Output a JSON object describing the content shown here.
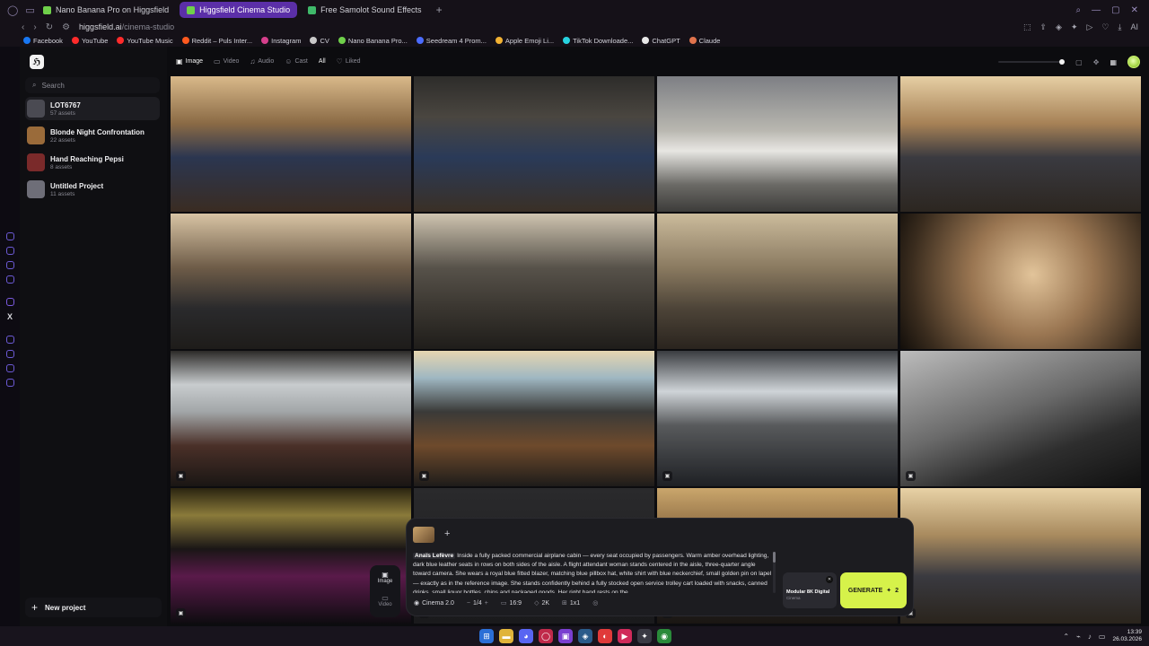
{
  "browser": {
    "tabs": [
      {
        "label": "Nano Banana Pro on Higgsfield",
        "color": "#6fd04a",
        "active": false
      },
      {
        "label": "Higgsfield Cinema Studio",
        "color": "#6fd04a",
        "active": true
      },
      {
        "label": "Free Samolot Sound Effects",
        "color": "#3fb96a",
        "active": false
      }
    ],
    "url_host": "higgsfield.ai",
    "url_path": "/cinema-studio",
    "extension_label": "AI",
    "bookmarks": [
      {
        "label": "Facebook",
        "color": "#1877f2"
      },
      {
        "label": "YouTube",
        "color": "#ff2b2b"
      },
      {
        "label": "YouTube Music",
        "color": "#ff2b2b"
      },
      {
        "label": "Reddit – Puls Inter...",
        "color": "#ff5a1f"
      },
      {
        "label": "Instagram",
        "color": "#d63f8c"
      },
      {
        "label": "CV",
        "color": "#c9c9c9"
      },
      {
        "label": "Nano Banana Pro...",
        "color": "#6fd04a"
      },
      {
        "label": "Seedream 4 Prom...",
        "color": "#4b6cff"
      },
      {
        "label": "Apple Emoji Li...",
        "color": "#f2b233"
      },
      {
        "label": "TikTok Downloade...",
        "color": "#27d3e0"
      },
      {
        "label": "ChatGPT",
        "color": "#e8e8e8"
      },
      {
        "label": "Claude",
        "color": "#e0734c"
      }
    ]
  },
  "sidebar": {
    "search_placeholder": "Search",
    "projects": [
      {
        "title": "LOT6767",
        "count": "57 assets",
        "thumb": "#4a4a52"
      },
      {
        "title": "Blonde Night Confrontation",
        "count": "22 assets",
        "thumb": "#9a6b3a"
      },
      {
        "title": "Hand Reaching Pepsi",
        "count": "8 assets",
        "thumb": "#7a2a2a"
      },
      {
        "title": "Untitled Project",
        "count": "11 assets",
        "thumb": "#6e6e78"
      }
    ],
    "new_project": "New project"
  },
  "filters": [
    {
      "label": "Image",
      "icon": "image-icon",
      "on": true
    },
    {
      "label": "Video",
      "icon": "video-icon",
      "on": false
    },
    {
      "label": "Audio",
      "icon": "audio-icon",
      "on": false
    },
    {
      "label": "Cast",
      "icon": "cast-icon",
      "on": false
    },
    {
      "label": "All",
      "icon": "",
      "on": true
    },
    {
      "label": "Liked",
      "icon": "heart-icon",
      "on": false
    }
  ],
  "grid_images": [
    {
      "name": "cabin-attendant-trolley",
      "bg": "linear-gradient(180deg,#d9b98a 0%,#8a6a45 35%,#2b3650 60%,#3a2c22 100%)"
    },
    {
      "name": "attendant-galley",
      "bg": "linear-gradient(180deg,#2d2c2a 0%,#4a4640 30%,#2a3a58 60%,#3a3026 100%)"
    },
    {
      "name": "plane-takeoff",
      "bg": "linear-gradient(180deg,#7d7f84 0%,#b9b7b0 40%,#e7e6e2 55%,#6b6a66 80%,#3d3c3a 100%)"
    },
    {
      "name": "passengers-boy-tablet",
      "bg": "linear-gradient(180deg,#e6cfa4 0%,#a68156 35%,#3a3a40 60%,#2c2620 100%)"
    },
    {
      "name": "empty-aisle-boy",
      "bg": "linear-gradient(180deg,#d8c4a4 0%,#6e5c48 40%,#2a2a2c 70%,#1e1c1a 100%)"
    },
    {
      "name": "boy-mother-gameboy",
      "bg": "linear-gradient(180deg,#cfc4b0 0%,#57524a 40%,#3a3630 70%,#1f1d1a 100%)"
    },
    {
      "name": "boy-mother-beige-seats",
      "bg": "linear-gradient(180deg,#cbbb9c 0%,#8a7a60 40%,#4d4438 70%,#2a241e 100%)"
    },
    {
      "name": "boy-mother-fisheye",
      "bg": "radial-gradient(circle at 55% 45%,#e2c49a 0%,#9a7652 40%,#3a2c1e 80%,#120e0a 100%)"
    },
    {
      "name": "cockpit-window-rain",
      "bg": "linear-gradient(180deg,#2c2a28 0%,#c8ccce 25%,#a2a6a8 45%,#4a3028 70%,#1a1614 100%)"
    },
    {
      "name": "cockpit-daylight",
      "bg": "linear-gradient(180deg,#e6d6b0 0%,#9fb7c2 20%,#3a3a38 45%,#6e4a2c 70%,#1e1c1a 100%)"
    },
    {
      "name": "pilot-cockpit",
      "bg": "linear-gradient(180deg,#3a3c40 0%,#cfd4d8 30%,#585a5c 55%,#1e2024 100%)"
    },
    {
      "name": "fuselage-closeup",
      "bg": "linear-gradient(160deg,#bcbcbc 0%,#6a6a6a 45%,#2e2e2e 70%,#101010 100%)"
    },
    {
      "name": "cockpit-night-pink",
      "bg": "linear-gradient(180deg,#2a2410 0%,#8a7a3a 20%,#1a1616 45%,#5a1a4a 65%,#0e0c10 100%)"
    },
    {
      "name": "dark-panel",
      "bg": "linear-gradient(180deg,#2a2a2c 0%,#1a1a1c 100%)"
    },
    {
      "name": "attendant-cabin-2",
      "bg": "linear-gradient(180deg,#caa66c 0%,#7a5a36 40%,#2a2a30 70%,#1a1612 100%)"
    },
    {
      "name": "attendant-cabin-3",
      "bg": "linear-gradient(180deg,#e8d2a6 0%,#a88a5e 35%,#3a3a40 65%,#2a241c 100%)"
    }
  ],
  "composer": {
    "mention": "Anaïs Lefèvre",
    "prompt": "Inside a fully packed commercial airplane cabin — every seat occupied by passengers. Warm amber overhead lighting, dark blue leather seats in rows on both sides of the aisle. A flight attendant woman stands centered in the aisle, three-quarter angle toward camera. She wears a royal blue fitted blazer, matching blue pillbox hat, white shirt with blue neckerchief, small golden pin on lapel — exactly as in the reference image. She stands confidently behind a fully stocked open service trolley cart loaded with snacks, canned drinks, small liquor bottles, chips and packaged goods. Her right hand rests on the",
    "options": {
      "model": "Cinema 2.0",
      "count": "1/4",
      "aspect": "16:9",
      "resolution": "2K",
      "ratio": "1x1"
    },
    "modes": [
      {
        "label": "Image",
        "icon": "image-icon"
      },
      {
        "label": "Video",
        "icon": "video-icon"
      }
    ],
    "model_card": {
      "title": "Modular 8K Digital",
      "subtitle": "Cinema"
    },
    "generate_label": "GENERATE",
    "generate_cost": "2"
  },
  "taskbar": {
    "time": "13:39",
    "date": "26.03.2026"
  }
}
